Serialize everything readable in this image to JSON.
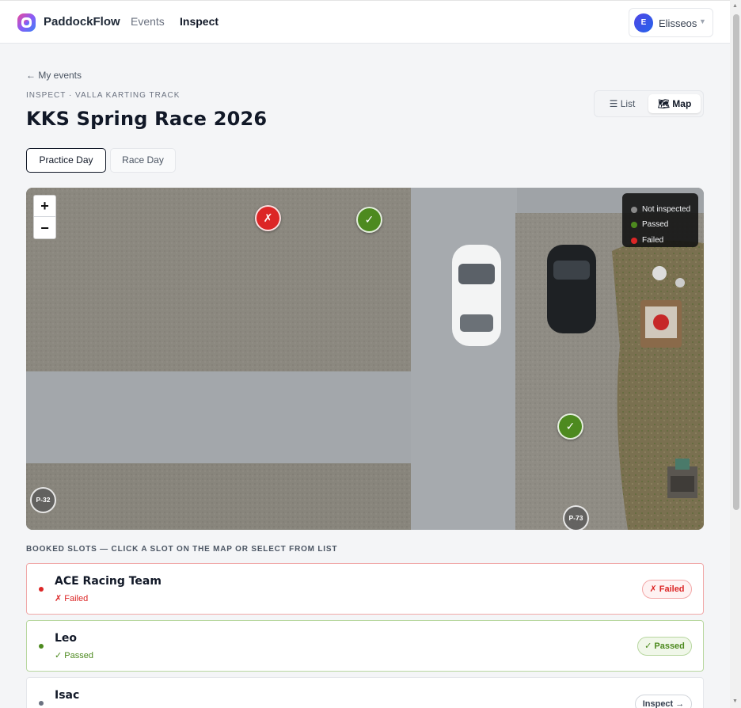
{
  "nav": {
    "brand": "PaddockFlow",
    "links": [
      {
        "label": "Events"
      },
      {
        "label": "Inspect"
      }
    ],
    "user": {
      "initial": "E",
      "name": "Elisseos",
      "caret": "▼"
    }
  },
  "page": {
    "back_link": "← My events",
    "kicker": "INSPECT · VALLA KARTING TRACK",
    "title": "KKS Spring Race 2026",
    "view_toggle": {
      "list": "☰ List",
      "map": "🗺 Map",
      "selected": "map"
    },
    "day_tabs": [
      {
        "label": "Practice Day",
        "active": true
      },
      {
        "label": "Race Day",
        "active": false
      }
    ]
  },
  "map": {
    "zoom_in": "+",
    "zoom_out": "−",
    "legend": [
      {
        "label": "Not inspected",
        "color": "#8a8a8a"
      },
      {
        "label": "Passed",
        "color": "#4d8a1f"
      },
      {
        "label": "Failed",
        "color": "#dc2626"
      }
    ],
    "markers": [
      {
        "type": "failed",
        "symbol": "✗"
      },
      {
        "type": "passed",
        "symbol": "✓"
      },
      {
        "type": "passed",
        "symbol": "✓"
      }
    ],
    "slot_labels": [
      "P-32",
      "P-73"
    ]
  },
  "slots": {
    "section_label": "BOOKED SLOTS — CLICK A SLOT ON THE MAP OR SELECT FROM LIST",
    "items": [
      {
        "name": "ACE Racing Team",
        "status_text": "✗ Failed",
        "badge": "✗ Failed",
        "state": "failed",
        "dot_color": "#dc2626"
      },
      {
        "name": "Leo",
        "status_text": "✓ Passed",
        "badge": "✓ Passed",
        "state": "passed",
        "dot_color": "#4d8a1f"
      },
      {
        "name": "Isac",
        "status_text": "",
        "badge": "Inspect →",
        "state": "pending",
        "dot_color": "#6b7280"
      }
    ]
  },
  "colors": {
    "failed": "#dc2626",
    "passed": "#4d8a1f",
    "not_inspected": "#8a8a8a",
    "accent": "#4f46e5"
  }
}
